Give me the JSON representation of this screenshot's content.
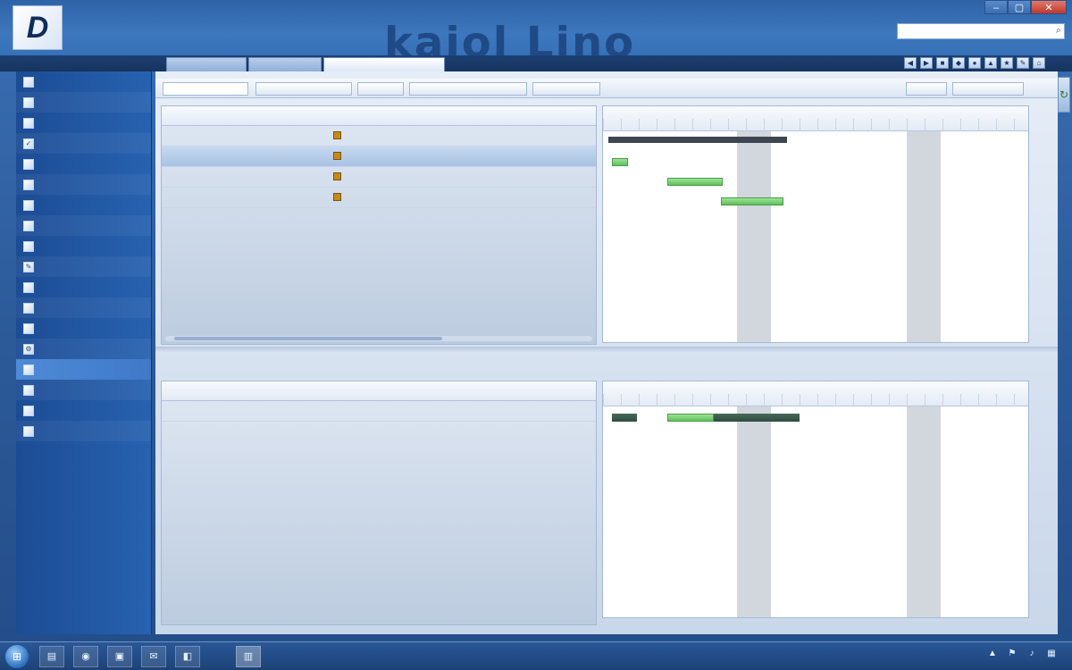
{
  "window": {
    "logo_text": "D",
    "title_lines": [
      "",
      ""
    ],
    "brand_banner": "kaiol Lino",
    "controls": [
      "–",
      "▢",
      "✕"
    ]
  },
  "search": {
    "placeholder": ""
  },
  "tabrow": {
    "main_menu": "",
    "tabs": [
      "",
      "",
      ""
    ],
    "toolbar_icons": [
      "◀",
      "▶",
      "■",
      "◆",
      "●",
      "▲",
      "★",
      "✎",
      "⌂"
    ]
  },
  "sidebar": {
    "items": [
      {
        "label": "",
        "icon": "page-icon"
      },
      {
        "label": "",
        "icon": "page-icon"
      },
      {
        "label": "",
        "icon": "page-icon"
      },
      {
        "label": "",
        "icon": "check-icon"
      },
      {
        "label": "",
        "icon": "page-icon"
      },
      {
        "label": "",
        "icon": "page-icon"
      },
      {
        "label": "",
        "icon": "page-icon"
      },
      {
        "label": "",
        "icon": "page-icon"
      },
      {
        "label": "",
        "icon": "page-icon"
      },
      {
        "label": "",
        "icon": "pencil-icon"
      },
      {
        "label": "",
        "icon": "page-icon"
      },
      {
        "label": "",
        "icon": "page-icon"
      },
      {
        "label": "",
        "icon": "page-icon"
      },
      {
        "label": "",
        "icon": "gear-icon"
      },
      {
        "label": "",
        "icon": "page-icon"
      },
      {
        "label": "",
        "icon": "page-icon"
      },
      {
        "label": "",
        "icon": "page-icon"
      },
      {
        "label": "",
        "icon": "page-icon"
      }
    ]
  },
  "action_bar": {
    "left_field": "",
    "buttons": [
      "",
      "",
      "",
      ""
    ],
    "right_buttons": [
      "",
      ""
    ]
  },
  "top_grid": {
    "columns": [
      "",
      "",
      "",
      "",
      ""
    ],
    "rows": [
      {
        "c0": "",
        "c1": "",
        "c2": "",
        "c3": "",
        "c4": ""
      },
      {
        "c0": "",
        "c1": "",
        "c2": "",
        "c3": "",
        "c4": ""
      },
      {
        "c0": "",
        "c1": "",
        "c2": "",
        "c3": "",
        "c4": ""
      },
      {
        "c0": "",
        "c1": "",
        "c2": "",
        "c3": "",
        "c4": ""
      }
    ]
  },
  "top_gantt": {
    "weeks": [
      "",
      "",
      ""
    ],
    "bar_labels": [
      "",
      "",
      "",
      ""
    ]
  },
  "section_label": "",
  "bottom_grid": {
    "columns": [
      "",
      "",
      "",
      "",
      "",
      ""
    ],
    "row": {
      "c0": "",
      "c1": "",
      "c2": "",
      "c3": "",
      "c4": "",
      "c5": ""
    }
  },
  "bottom_gantt": {
    "weeks": [
      "",
      "",
      ""
    ]
  },
  "taskbar": {
    "start": "⊞",
    "buttons": [
      "▤",
      "◉",
      "▣",
      "✉",
      "◧",
      "▥"
    ],
    "tray_icons": [
      "▲",
      "⚑",
      "♪",
      "▦"
    ],
    "clock_time": "",
    "clock_date": ""
  }
}
